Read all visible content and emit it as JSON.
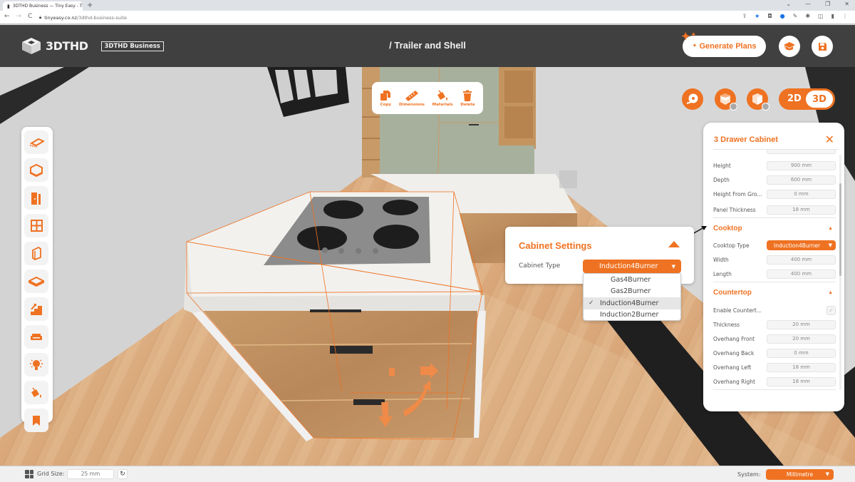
{
  "browser": {
    "tab_title": "3DTHD Business — Tiny Easy - Ti",
    "tab_close": "×",
    "new_tab": "+",
    "url_host": "tinyeasy.co.nz",
    "url_path": "/3dthd-business-suite",
    "nav": {
      "back": "←",
      "forward": "→",
      "reload": "C"
    },
    "window_controls": [
      "⌄",
      "—",
      "❐",
      "✕"
    ]
  },
  "header": {
    "logo_text": "3DTHD",
    "badge": "3DTHD Business",
    "page_title": "/ Trailer and Shell",
    "generate_plans": "Generate Plans"
  },
  "object_toolbar": [
    {
      "label": "Copy",
      "icon": "copy-icon"
    },
    {
      "label": "Dimensions",
      "icon": "ruler-icon"
    },
    {
      "label": "Materials",
      "icon": "paint-bucket-icon"
    },
    {
      "label": "Delete",
      "icon": "trash-icon"
    }
  ],
  "view_toggle": {
    "option_2d": "2D",
    "option_3d": "3D",
    "active": "3D"
  },
  "sidebar": [
    {
      "name": "floor",
      "icon": "floor-icon"
    },
    {
      "name": "room",
      "icon": "cube-room-icon"
    },
    {
      "name": "door",
      "icon": "door-icon"
    },
    {
      "name": "window",
      "icon": "window-icon"
    },
    {
      "name": "wall-panel",
      "icon": "panel-icon"
    },
    {
      "name": "platform",
      "icon": "platform-icon"
    },
    {
      "name": "stairs",
      "icon": "stairs-icon"
    },
    {
      "name": "furniture",
      "icon": "sofa-icon"
    },
    {
      "name": "lighting",
      "icon": "lightbulb-icon"
    },
    {
      "name": "materials",
      "icon": "paint-bucket-icon"
    },
    {
      "name": "bookmark",
      "icon": "bookmark-icon"
    }
  ],
  "panel": {
    "title": "3 Drawer Cabinet",
    "close": "✕",
    "rows_top": [
      {
        "label": "Height",
        "value": "900 mm"
      },
      {
        "label": "Depth",
        "value": "600 mm"
      },
      {
        "label": "Height From Gro...",
        "value": "0 mm"
      },
      {
        "label": "Panel Thickness",
        "value": "18 mm"
      }
    ],
    "cooktop": {
      "title": "Cooktop",
      "type_label": "Cooktop Type",
      "type_value": "Induction4Burner",
      "rows": [
        {
          "label": "Width",
          "value": "400 mm"
        },
        {
          "label": "Length",
          "value": "400 mm"
        }
      ]
    },
    "countertop": {
      "title": "Countertop",
      "enable_label": "Enable Countert...",
      "enable_checked": true,
      "rows": [
        {
          "label": "Thickness",
          "value": "20 mm"
        },
        {
          "label": "Overhang Front",
          "value": "20 mm"
        },
        {
          "label": "Overhang Back",
          "value": "0 mm"
        },
        {
          "label": "Overhang Left",
          "value": "18 mm"
        },
        {
          "label": "Overhang Right",
          "value": "18 mm"
        }
      ]
    }
  },
  "cabinet_settings": {
    "title": "Cabinet Settings",
    "type_label": "Cabinet Type",
    "selected": "Induction4Burner",
    "options": [
      "Gas4Burner",
      "Gas2Burner",
      "Induction4Burner",
      "Induction2Burner"
    ]
  },
  "bottom_bar": {
    "grid_label": "Grid Size:",
    "grid_value": "25 mm",
    "reset": "↻",
    "system_label": "System:",
    "system_value": "Millimetre"
  },
  "colors": {
    "accent": "#ef7222",
    "header_bg": "#404040"
  }
}
